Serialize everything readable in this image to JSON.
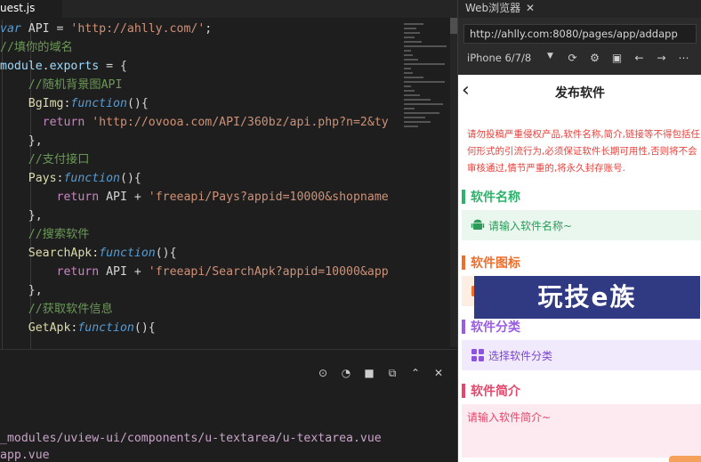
{
  "editor": {
    "tab_label": "uest.js",
    "lines": [
      {
        "parts": [
          [
            "kw",
            "var"
          ],
          [
            "plain",
            " API = "
          ],
          [
            "str",
            "'http://ahlly.com/'"
          ],
          [
            "plain",
            ";"
          ]
        ]
      },
      {
        "parts": [
          [
            "cm",
            "//填你的域名"
          ]
        ]
      },
      {
        "parts": [
          [
            "id",
            "module"
          ],
          [
            "plain",
            "."
          ],
          [
            "id",
            "exports"
          ],
          [
            "plain",
            " = {"
          ]
        ]
      },
      {
        "parts": [
          [
            "plain",
            "    "
          ],
          [
            "cm",
            "//随机背景图API"
          ]
        ]
      },
      {
        "parts": [
          [
            "plain",
            "    "
          ],
          [
            "fn",
            "BgImg"
          ],
          [
            "plain",
            ":"
          ],
          [
            "func",
            "function"
          ],
          [
            "plain",
            "(){"
          ]
        ]
      },
      {
        "parts": [
          [
            "plain",
            "      "
          ],
          [
            "ret",
            "return"
          ],
          [
            "plain",
            " "
          ],
          [
            "str",
            "'http://ovooa.com/API/360bz/api.php?n=2&ty"
          ]
        ]
      },
      {
        "parts": [
          [
            "plain",
            "    },"
          ]
        ]
      },
      {
        "parts": [
          [
            "plain",
            "    "
          ],
          [
            "cm",
            "//支付接口"
          ]
        ]
      },
      {
        "parts": [
          [
            "plain",
            "    "
          ],
          [
            "fn",
            "Pays"
          ],
          [
            "plain",
            ":"
          ],
          [
            "func",
            "function"
          ],
          [
            "plain",
            "(){"
          ]
        ]
      },
      {
        "parts": [
          [
            "plain",
            "        "
          ],
          [
            "ret",
            "return"
          ],
          [
            "plain",
            " API + "
          ],
          [
            "str",
            "'freeapi/Pays?appid=10000&shopname"
          ]
        ]
      },
      {
        "parts": [
          [
            "plain",
            "    },"
          ]
        ]
      },
      {
        "parts": [
          [
            "plain",
            "    "
          ],
          [
            "cm",
            "//搜索软件"
          ]
        ]
      },
      {
        "parts": [
          [
            "plain",
            "    "
          ],
          [
            "fn",
            "SearchApk"
          ],
          [
            "plain",
            ":"
          ],
          [
            "func",
            "function"
          ],
          [
            "plain",
            "(){"
          ]
        ]
      },
      {
        "parts": [
          [
            "plain",
            "        "
          ],
          [
            "ret",
            "return"
          ],
          [
            "plain",
            " API + "
          ],
          [
            "str",
            "'freeapi/SearchApk?appid=10000&app"
          ]
        ]
      },
      {
        "parts": [
          [
            "plain",
            "    },"
          ]
        ]
      },
      {
        "parts": [
          [
            "plain",
            "    "
          ],
          [
            "cm",
            "//获取软件信息"
          ]
        ]
      },
      {
        "parts": [
          [
            "plain",
            "    "
          ],
          [
            "fn",
            "GetApk"
          ],
          [
            "plain",
            ":"
          ],
          [
            "func",
            "function"
          ],
          [
            "plain",
            "(){"
          ]
        ]
      }
    ]
  },
  "panel": {
    "paths": [
      "_modules/uview-ui/components/u-textarea/u-textarea.vue",
      "app.vue"
    ]
  },
  "browser": {
    "tab_label": "Web浏览器",
    "close_glyph": "✕",
    "url": "http://ahlly.com:8080/pages/app/addapp",
    "device": "iPhone 6/7/8",
    "caret": "▼",
    "nav_title": "发布软件",
    "back_glyph": "‹",
    "notice": "请勿投稿严重侵权产品,软件名称,简介,链接等不得包括任何形式的引流行为,必须保证软件长期可用性,否则将不会审核通过,情节严重的,将永久封存账号.",
    "sections": [
      {
        "title": "软件名称",
        "color": "#2db36b",
        "field_text": "请输入软件名称~",
        "field_bg": "#e9f7ef",
        "field_color": "#2d9a5a",
        "icon": "android-icon"
      },
      {
        "title": "软件图标",
        "color": "#f06d2a",
        "field_text": "",
        "field_bg": "#fdeee4",
        "field_color": "#f06d2a",
        "icon": "image-icon"
      },
      {
        "title": "软件分类",
        "color": "#9a5ce6",
        "field_text": "选择软件分类",
        "field_bg": "#f1e9fc",
        "field_color": "#7a48c8",
        "icon": "grid-icon"
      },
      {
        "title": "软件简介",
        "color": "#e8456a",
        "field_text": "请输入软件简介~",
        "field_bg": "#fdeaf0",
        "field_color": "#e8456a",
        "icon": ""
      }
    ],
    "watermark": "玩技e族"
  }
}
